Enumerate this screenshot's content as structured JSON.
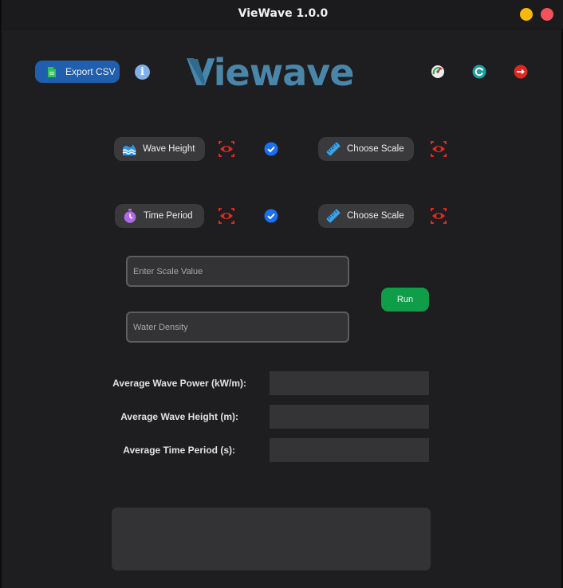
{
  "window": {
    "title": "VieWave 1.0.0"
  },
  "header": {
    "export_label": "Export CSV",
    "logo_text": "Viewave",
    "logo_color": "#4a86aa"
  },
  "rows": [
    {
      "input_label": "Wave Height",
      "scale_label": "Choose Scale"
    },
    {
      "input_label": "Time Period",
      "scale_label": "Choose Scale"
    }
  ],
  "fields": {
    "scale_placeholder": "Enter Scale Value",
    "density_placeholder": "Water Density"
  },
  "run_label": "Run",
  "results": {
    "power_label": "Average Wave Power (kW/m):",
    "height_label": "Average Wave Height (m):",
    "period_label": "Average Time Period (s):"
  },
  "colors": {
    "accent_blue": "#1f5fae",
    "run_green": "#0f9d4a",
    "status_red": "#e0281f",
    "check_blue": "#1c6ef2"
  }
}
